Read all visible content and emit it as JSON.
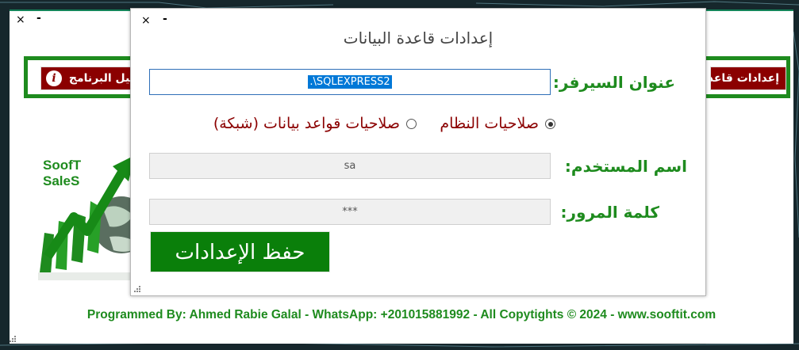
{
  "main_window": {
    "activate_button": "تفعيل البرنامج",
    "info_badge": "i",
    "settings_button": "إعدادات قاعدة",
    "logo_line1": "SoofT",
    "logo_line2": "SaleS",
    "footer": "Programmed By: Ahmed Rabie Galal - WhatsApp: +201015881992 - All Copytights © 2024 - www.sooftit.com"
  },
  "dialog": {
    "close_glyph": "×",
    "minimize_glyph": "-",
    "title": "إعدادات قاعدة البيانات",
    "server_label": "عنوان السيرفر:",
    "server_value": ".\\SQLEXPRESS2",
    "auth_system_label": "صلاحيات النظام",
    "auth_network_label": "صلاحيات قواعد بيانات (شبكة)",
    "auth_selected": "system",
    "username_label": "اسم المستخدم:",
    "username_value": "sa",
    "password_label": "كلمة المرور:",
    "password_value": "***",
    "save_button": "حفظ الإعدادات"
  },
  "colors": {
    "accent_green": "#1e8b1e",
    "maroon": "#8b0000",
    "selection_blue": "#0078d7"
  }
}
